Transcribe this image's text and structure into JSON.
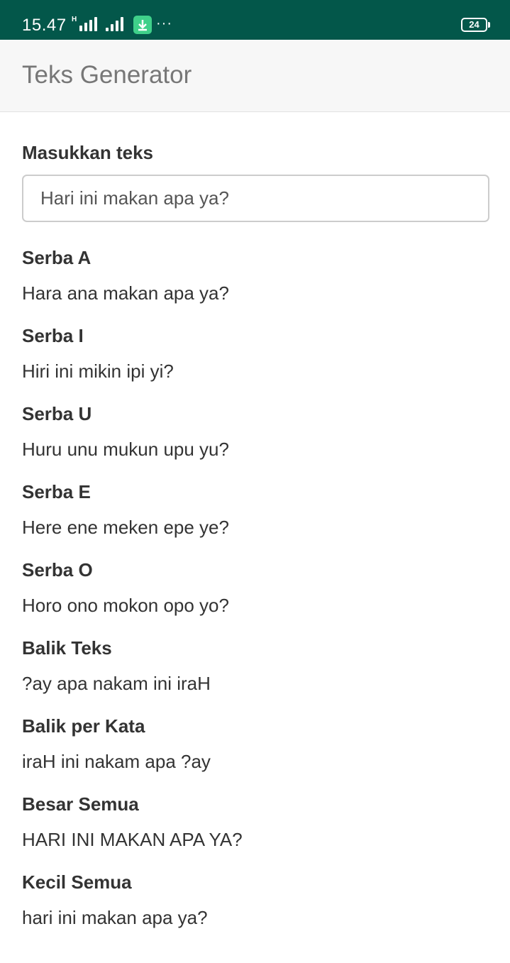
{
  "status_bar": {
    "time": "15.47",
    "network_indicator": "H",
    "more": "···",
    "battery": "24"
  },
  "app_bar": {
    "title": "Teks Generator"
  },
  "input": {
    "label": "Masukkan teks",
    "value": "Hari ini makan apa ya?"
  },
  "results": [
    {
      "title": "Serba A",
      "value": "Hara ana makan apa ya?"
    },
    {
      "title": "Serba I",
      "value": "Hiri ini mikin ipi yi?"
    },
    {
      "title": "Serba U",
      "value": "Huru unu mukun upu yu?"
    },
    {
      "title": "Serba E",
      "value": "Here ene meken epe ye?"
    },
    {
      "title": "Serba O",
      "value": "Horo ono mokon opo yo?"
    },
    {
      "title": "Balik Teks",
      "value": "?ay apa nakam ini iraH"
    },
    {
      "title": "Balik per Kata",
      "value": "iraH ini nakam apa ?ay"
    },
    {
      "title": "Besar Semua",
      "value": "HARI INI MAKAN APA YA?"
    },
    {
      "title": "Kecil Semua",
      "value": "hari ini makan apa ya?"
    }
  ]
}
